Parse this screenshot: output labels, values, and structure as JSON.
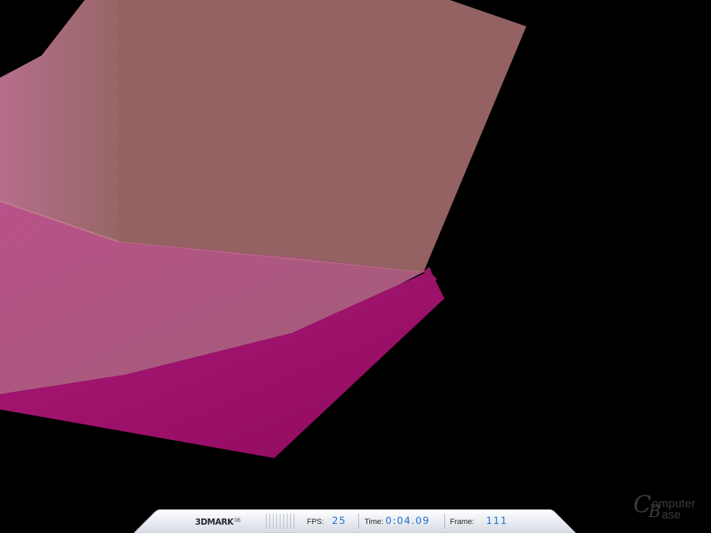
{
  "scene": {
    "colors": {
      "background": "#000000",
      "upper_face": "#946262",
      "middle_face": "#a05a78",
      "lower_face": "#961464",
      "edge_highlight": "#c88a8a"
    }
  },
  "hud": {
    "brand": "3DMARK",
    "brand_version": "06",
    "fps_label": "FPS:",
    "fps_value": "25",
    "time_label": "Time:",
    "time_value": "0:04.09",
    "frame_label": "Frame:",
    "frame_value": "111"
  },
  "watermark": {
    "letter_c": "C",
    "letter_b": "B",
    "text_top": "omputer",
    "text_bottom": "ase"
  }
}
